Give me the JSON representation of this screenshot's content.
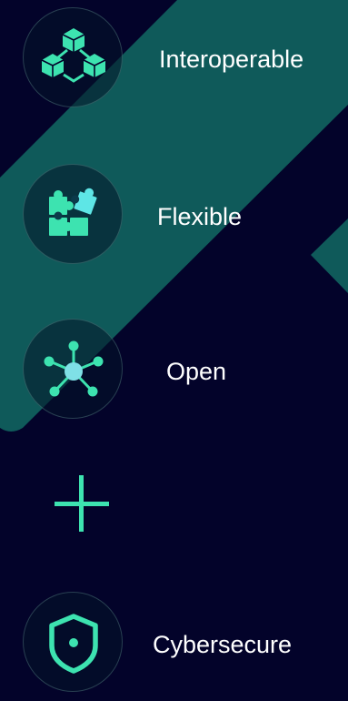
{
  "features": [
    {
      "label": "Interoperable",
      "icon": "connected-cubes-icon"
    },
    {
      "label": "Flexible",
      "icon": "puzzle-pieces-icon"
    },
    {
      "label": "Open",
      "icon": "network-hub-icon"
    },
    {
      "label": "Cybersecure",
      "icon": "shield-icon"
    }
  ],
  "plus_icon": "plus-icon",
  "colors": {
    "background": "#03032a",
    "teal_band": "#0f5a5a",
    "accent": "#3de3b0"
  }
}
